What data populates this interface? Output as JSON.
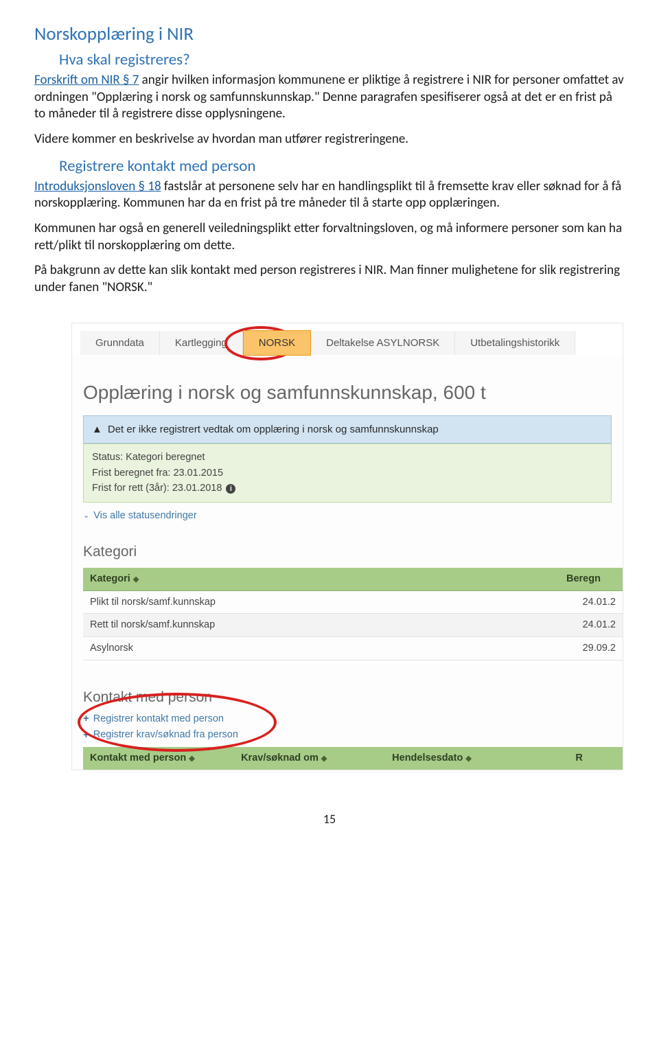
{
  "article": {
    "title": "Norskopplæring i NIR",
    "subtitle": "Hva skal registreres?",
    "p1_link": "Forskrift om NIR § 7",
    "p1_rest": " angir hvilken informasjon kommunene er pliktige å registrere i NIR for personer omfattet av ordningen \"Opplæring i norsk og samfunnskunnskap.\" Denne paragrafen spesifiserer også at det er en frist på to måneder til å registrere disse opplysningene.",
    "p2": "Videre kommer en beskrivelse av hvordan man utfører registreringene.",
    "h3": "Registrere kontakt med person",
    "p3_link": "Introduksjonsloven § 18",
    "p3_rest": " fastslår at personene selv har en handlingsplikt til å fremsette krav eller søknad for å få norskopplæring. Kommunen har da en frist på tre måneder til å starte opp opplæringen.",
    "p4": "Kommunen har også en generell veiledningsplikt etter forvaltningsloven, og må informere personer som kan ha rett/plikt til norskopplæring om dette.",
    "p5": "På bakgrunn av dette kan slik kontakt med person registreres i NIR. Man finner mulighetene for slik registrering under fanen \"NORSK.\""
  },
  "screenshot": {
    "tabs": {
      "grunndata": "Grunndata",
      "kartlegging": "Kartlegging",
      "norsk": "NORSK",
      "deltakelse": "Deltakelse ASYLNORSK",
      "utbetaling": "Utbetalingshistorikk"
    },
    "section_heading": "Opplæring i norsk og samfunnskunnskap, 600 t",
    "alert": "Det er ikke registrert vedtak om opplæring i norsk og samfunnskunnskap",
    "status": {
      "line1": "Status: Kategori beregnet",
      "line2": "Frist beregnet fra: 23.01.2015",
      "line3": "Frist for rett (3år): 23.01.2018"
    },
    "expand": "Vis alle statusendringer",
    "kategori": {
      "title": "Kategori",
      "col_kat": "Kategori",
      "col_beregn": "Beregn",
      "rows": [
        {
          "label": "Plikt til norsk/samf.kunnskap",
          "date": "24.01.2"
        },
        {
          "label": "Rett til norsk/samf.kunnskap",
          "date": "24.01.2"
        },
        {
          "label": "Asylnorsk",
          "date": "29.09.2"
        }
      ]
    },
    "kontakt": {
      "title": "Kontakt med person",
      "add1": "Registrer kontakt med person",
      "add2": "Registrer krav/søknad fra person",
      "col1": "Kontakt med person",
      "col2": "Krav/søknad om",
      "col3": "Hendelsesdato",
      "col4": "R"
    }
  },
  "page_number": "15"
}
